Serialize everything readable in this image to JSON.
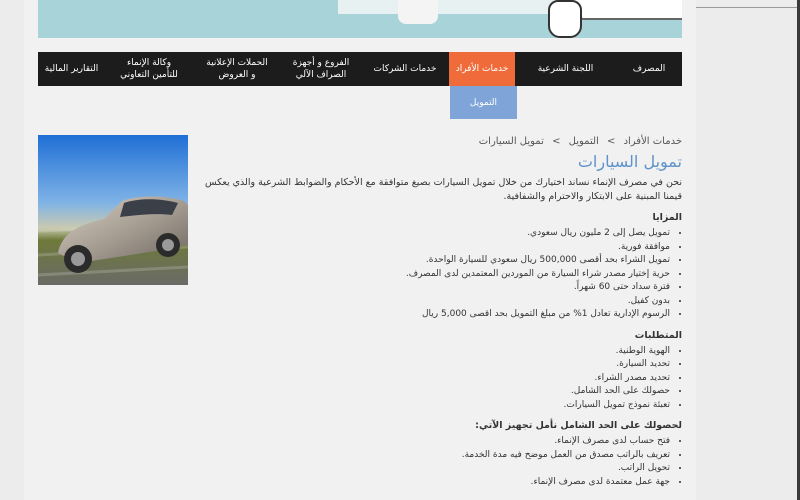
{
  "nav": {
    "items": [
      {
        "label": "المصرف"
      },
      {
        "label": "اللجنة الشرعية"
      },
      {
        "label": "خدمات الأفراد",
        "active": true
      },
      {
        "label": "خدمات الشركات"
      },
      {
        "label": "الفروع و أجهزة الصراف الآلي"
      },
      {
        "label": "الحملات الإعلانية و العروض"
      },
      {
        "label": "وكالة الإنماء للتأمين التعاوني"
      },
      {
        "label": "التقارير المالية"
      }
    ],
    "sub_item": "التمويل",
    "active_color": "#ef6b3a",
    "sub_color": "#7ea4d8"
  },
  "breadcrumb": [
    "خدمات الأفراد",
    "التمويل",
    "تمويل السيارات"
  ],
  "breadcrumb_separator": ">",
  "page_title": "تمويل السيارات",
  "intro": "نحن في مصرف الإنماء نساند اختيارك من خلال تمويل السيارات بصيغ متوافقة مع الأحكام والضوابط الشرعية والذي يعكس قيمنا المبنية على الابتكار والاحترام والشفافية.",
  "sections": [
    {
      "heading": "المزايا",
      "items": [
        "تمويل يصل إلى 2 مليون ريال سعودي.",
        "موافقة فورية.",
        "تمويل الشراء بحد أقصى 500,000 ريال سعودي للسيارة الواحدة.",
        "حرية إختيار مصدر شراء السيارة من الموردين المعتمدين لدى المصرف.",
        "فترة سداد حتى 60 شهراً.",
        "بدون كفيل.",
        "الرسوم الإدارية تعادل 1% من مبلغ التمويل بحد اقصى 5,000 ريال"
      ]
    },
    {
      "heading": "المتطلبات",
      "items": [
        "الهوية الوطنية.",
        "تحديد السيارة.",
        "تحديد مصدر الشراء.",
        "حصولك على الحد الشامل.",
        "تعبئة نموذج تمويل السيارات."
      ]
    },
    {
      "heading": "لحصولك على الحد الشامل نأمل تجهيز الآتي:",
      "items": [
        "فتح حساب لدى مصرف الإنماء.",
        "تعريف بالراتب مصدق من العمل موضح فيه مدة الخدمة.",
        "تحويل الراتب.",
        "جهة عمل معتمدة لدى مصرف الإنماء."
      ]
    }
  ],
  "colors": {
    "title": "#5e93c9",
    "nav_bg": "#1c1c1c"
  }
}
